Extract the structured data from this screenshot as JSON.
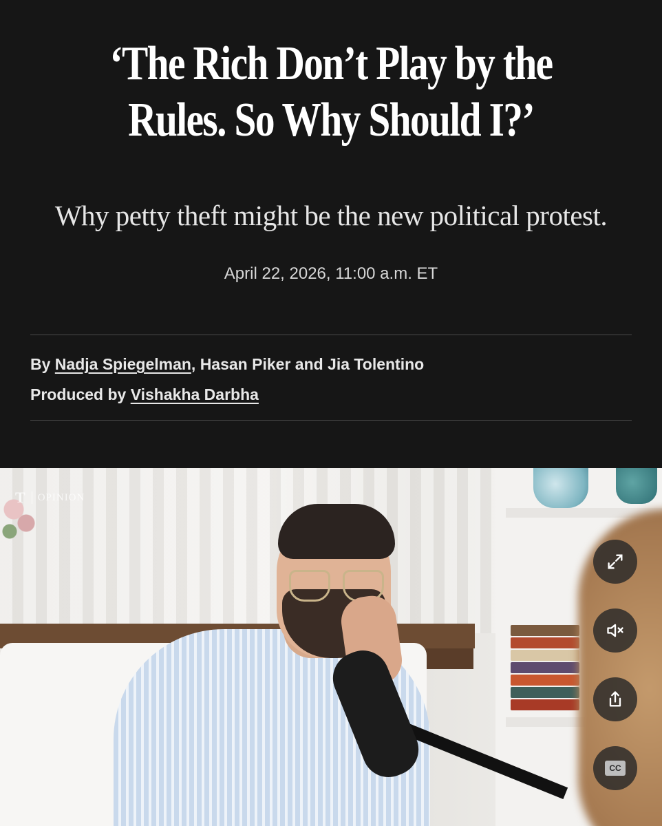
{
  "article": {
    "headline": "‘The Rich Don’t Play by the Rules. So Why Should I?’",
    "dek": "Why petty theft might be the new political protest.",
    "dateline": "April 22, 2026, 11:00 a.m. ET"
  },
  "credits": {
    "by_prefix": "By",
    "author_1": "Nadja Spiegelman",
    "author_rest": ", Hasan Piker and Jia Tolentino",
    "produced_prefix": "Produced by",
    "producer": "Vishakha Darbha"
  },
  "video": {
    "watermark_logo": "T",
    "watermark_section": "OPINION",
    "controls": {
      "expand_icon": "expand-icon",
      "mute_icon": "volume-muted-icon",
      "share_icon": "share-icon",
      "cc_label": "CC"
    }
  },
  "colors": {
    "background": "#161616",
    "text": "#f2f2f2",
    "rule": "#4a4a4a",
    "control_bg": "#282828"
  }
}
